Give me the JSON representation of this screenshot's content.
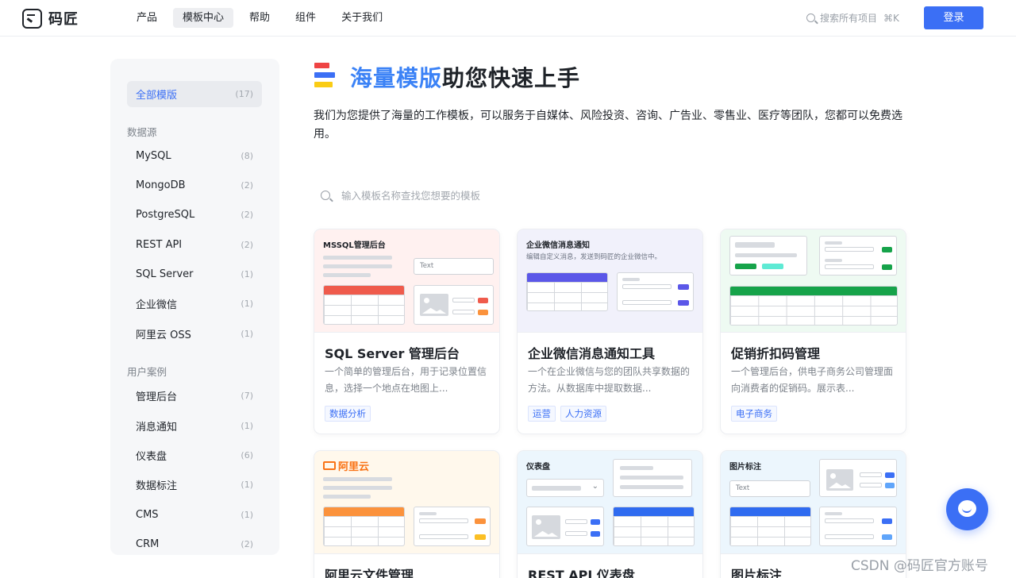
{
  "header": {
    "logo_text": "码匠",
    "nav": [
      "产品",
      "模板中心",
      "帮助",
      "组件",
      "关于我们"
    ],
    "active_nav": "模板中心",
    "search_placeholder": "搜索所有项目",
    "search_shortcut": "⌘K",
    "login_label": "登录"
  },
  "sidebar": {
    "all": {
      "label": "全部模版",
      "count": "(17)"
    },
    "groups": [
      {
        "title": "数据源",
        "items": [
          {
            "label": "MySQL",
            "count": "(8)"
          },
          {
            "label": "MongoDB",
            "count": "(2)"
          },
          {
            "label": "PostgreSQL",
            "count": "(2)"
          },
          {
            "label": "REST API",
            "count": "(2)"
          },
          {
            "label": "SQL Server",
            "count": "(1)"
          },
          {
            "label": "企业微信",
            "count": "(1)"
          },
          {
            "label": "阿里云 OSS",
            "count": "(1)"
          }
        ]
      },
      {
        "title": "用户案例",
        "items": [
          {
            "label": "管理后台",
            "count": "(7)"
          },
          {
            "label": "消息通知",
            "count": "(1)"
          },
          {
            "label": "仪表盘",
            "count": "(6)"
          },
          {
            "label": "数据标注",
            "count": "(1)"
          },
          {
            "label": "CMS",
            "count": "(1)"
          },
          {
            "label": "CRM",
            "count": "(2)"
          }
        ]
      }
    ]
  },
  "hero": {
    "title_highlight": "海量模版",
    "title_rest": "助您快速上手",
    "description": "我们为您提供了海量的工作模板，可以服务于自媒体、风险投资、咨询、广告业、零售业、医疗等团队，您都可以免费选用。",
    "search_placeholder": "输入模板名称查找您想要的模板"
  },
  "cards": [
    {
      "thumb_title": "MSSQL管理后台",
      "thumb_input": "Text",
      "title": "SQL Server 管理后台",
      "desc": "一个简单的管理后台，用于记录位置信息，选择一个地点在地图上...",
      "tags": [
        "数据分析"
      ]
    },
    {
      "thumb_title": "企业微信消息通知",
      "thumb_sub": "编辑自定义消息，发送到码匠的企业微信中。",
      "title": "企业微信消息通知工具",
      "desc": "一个在企业微信与您的团队共享数据的方法。从数据库中提取数据...",
      "tags": [
        "运营",
        "人力资源"
      ]
    },
    {
      "title": "促销折扣码管理",
      "desc": "一个管理后台，供电子商务公司管理面向消费者的促销码。展示表...",
      "tags": [
        "电子商务"
      ]
    },
    {
      "thumb_logo": "阿里云",
      "title": "阿里云文件管理"
    },
    {
      "thumb_title": "仪表盘",
      "title": "REST API 仪表盘"
    },
    {
      "thumb_title": "图片标注",
      "thumb_input": "Text",
      "title": "图片标注"
    }
  ],
  "watermark": "CSDN @码匠官方账号",
  "colors": {
    "accent": "#3b6ff5",
    "highlight": "#3b82f6",
    "red": "#ef4444",
    "green": "#16a34a",
    "orange": "#fb923c"
  }
}
